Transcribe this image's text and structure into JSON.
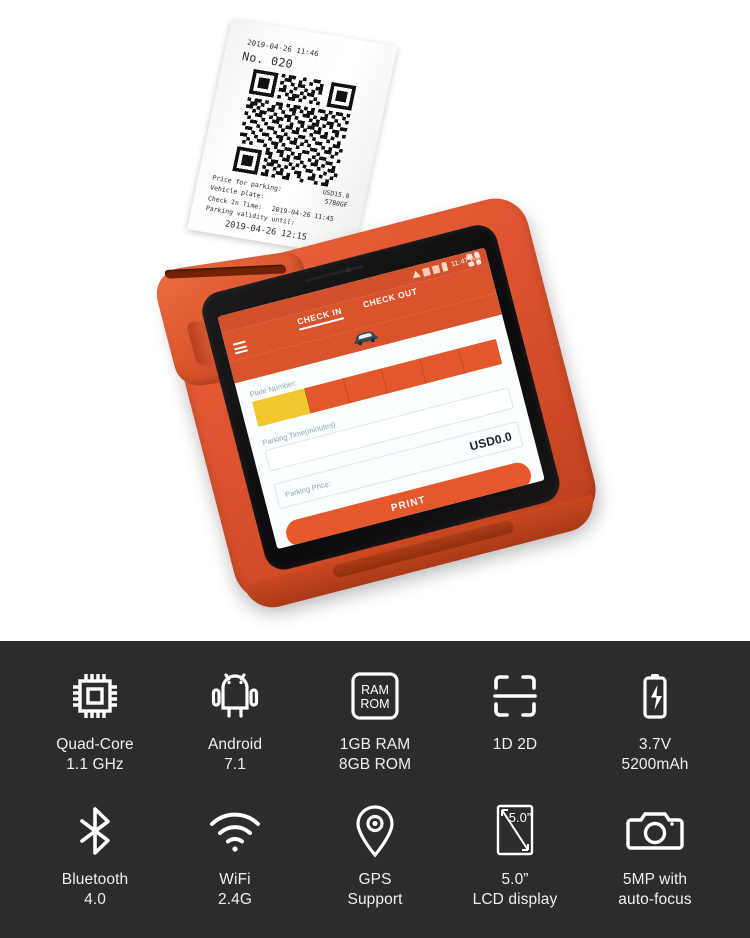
{
  "product": {
    "device_color": "#d9542c",
    "panel_bg": "#2c2c2c"
  },
  "receipt": {
    "timestamp": "2019-04-26 11:46",
    "number": "No. 020",
    "price_value": "USD15.0",
    "plate_value": "5780GF",
    "line_price_label": "Price for parking:",
    "line_plate_label": "Vehicle plate:",
    "line_checkin_label": "Check In Time:",
    "line_checkin_value": "2019-04-26 11:45",
    "line_validity_label": "Parking validity until:",
    "line_validity_value": "2019-04-26 12:15"
  },
  "screen": {
    "status_time": "11:47 AM",
    "tabs": [
      {
        "label": "CHECK IN",
        "active": true
      },
      {
        "label": "CHECK OUT",
        "active": false
      }
    ],
    "plate_label": "Plate Number:",
    "time_label": "Parking Time(minutes)",
    "price_label": "Parking Price:",
    "price_value": "USD0.0",
    "print_label": "PRINT",
    "plate_cells": [
      "",
      "",
      "",
      "",
      "",
      ""
    ],
    "menu_icon": "hamburger-icon",
    "apps_icon": "grid-apps-icon",
    "vehicle_icon": "car-icon",
    "nav": [
      "back-icon",
      "home-icon",
      "recents-icon"
    ]
  },
  "specs": {
    "row1": [
      {
        "icon": "cpu-chip-icon",
        "line1": "Quad-Core",
        "line2": "1.1 GHz"
      },
      {
        "icon": "android-robot-icon",
        "line1": "Android",
        "line2": "7.1"
      },
      {
        "icon": "ram-rom-icon",
        "line1": "1GB RAM",
        "line2": "8GB ROM",
        "badge_line1": "RAM",
        "badge_line2": "ROM"
      },
      {
        "icon": "barcode-scanner-icon",
        "line1": "1D 2D",
        "line2": ""
      },
      {
        "icon": "battery-icon",
        "line1": "3.7V",
        "line2": "5200mAh"
      }
    ],
    "row2": [
      {
        "icon": "bluetooth-icon",
        "line1": "Bluetooth",
        "line2": "4.0"
      },
      {
        "icon": "wifi-icon",
        "line1": "WiFi",
        "line2": "2.4G"
      },
      {
        "icon": "gps-pin-icon",
        "line1": "GPS",
        "line2": "Support"
      },
      {
        "icon": "screen-diagonal-icon",
        "line1": "5.0”",
        "line2": "LCD display",
        "badge_line1": "5.0”"
      },
      {
        "icon": "camera-icon",
        "line1": "5MP with",
        "line2": "auto-focus"
      }
    ]
  }
}
